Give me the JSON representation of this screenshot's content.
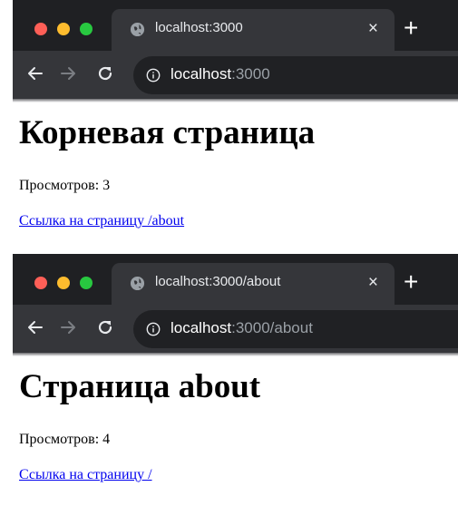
{
  "windows": [
    {
      "tab": {
        "title": "localhost:3000",
        "close": "×",
        "new_tab": "+"
      },
      "address": {
        "host": "localhost",
        "rest": ":3000"
      },
      "page": {
        "heading": "Корневая страница",
        "views": "Просмотров: 3",
        "link": "Ссылка на страницу /about"
      }
    },
    {
      "tab": {
        "title": "localhost:3000/about",
        "close": "×",
        "new_tab": "+"
      },
      "address": {
        "host": "localhost",
        "rest": ":3000/about"
      },
      "page": {
        "heading": "Страница about",
        "views": "Просмотров: 4",
        "link": "Ссылка на страницу /"
      }
    }
  ],
  "colors": {
    "tabbar_bg": "#1f2023",
    "toolbar_bg": "#35363a",
    "omnibox_bg": "#202124",
    "traffic_red": "#fe5f57",
    "traffic_yellow": "#febc2e",
    "traffic_green": "#28c840",
    "link": "#0000ee"
  },
  "icons": [
    "globe-icon",
    "close-icon",
    "plus-icon",
    "back-arrow-icon",
    "forward-arrow-icon",
    "reload-icon",
    "info-icon"
  ]
}
